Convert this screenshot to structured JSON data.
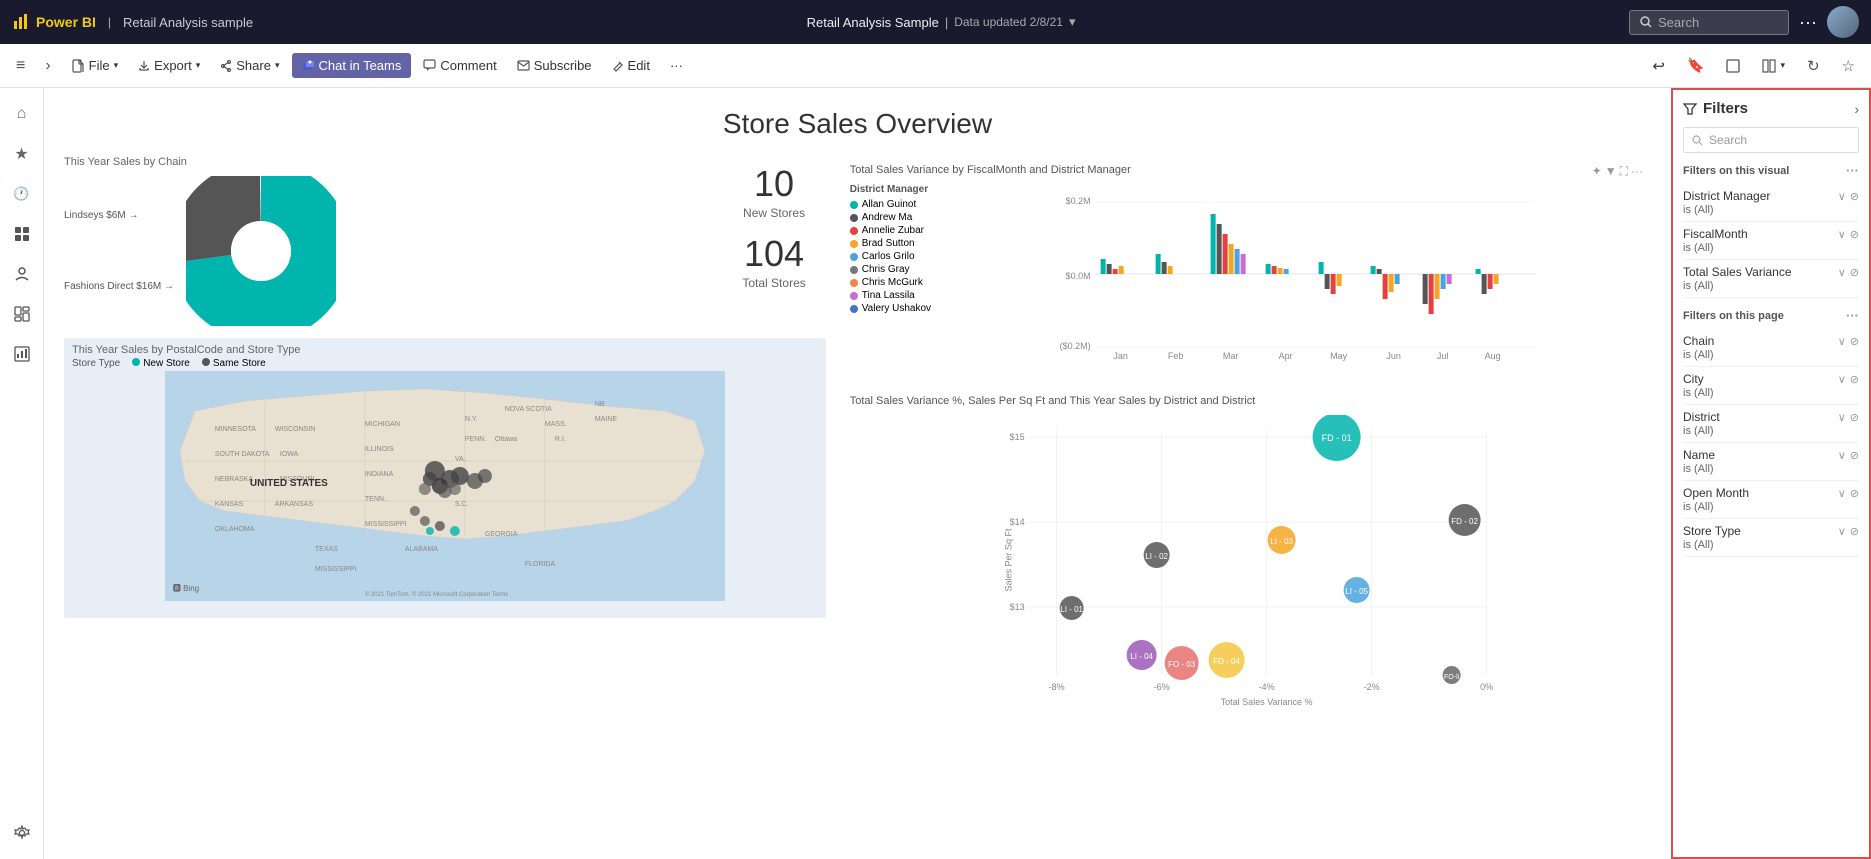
{
  "topbar": {
    "logo": "Power BI",
    "report_title": "Retail Analysis sample",
    "center_title": "Retail Analysis Sample",
    "separator": "|",
    "data_updated": "Data updated 2/8/21",
    "dropdown_icon": "▾",
    "search_placeholder": "Search",
    "more_icon": "···"
  },
  "secondbar": {
    "menu_icon": "≡",
    "chevron": "›",
    "file_label": "File",
    "export_label": "Export",
    "share_label": "Share",
    "chat_label": "Chat in Teams",
    "comment_label": "Comment",
    "subscribe_label": "Subscribe",
    "edit_label": "Edit",
    "more": "···",
    "undo_icon": "↩",
    "bookmark_icon": "🔖",
    "fullscreen_icon": "⛶",
    "refresh_icon": "↻",
    "favorite_icon": "☆"
  },
  "sidebar": {
    "icons": [
      {
        "name": "home",
        "symbol": "⌂",
        "active": false
      },
      {
        "name": "favorites",
        "symbol": "★",
        "active": false
      },
      {
        "name": "recent",
        "symbol": "🕐",
        "active": false
      },
      {
        "name": "apps",
        "symbol": "⊞",
        "active": false
      },
      {
        "name": "shared",
        "symbol": "👤",
        "active": false
      },
      {
        "name": "workspaces",
        "symbol": "◫",
        "active": false
      },
      {
        "name": "metrics",
        "symbol": "⊟",
        "active": false
      },
      {
        "name": "settings",
        "symbol": "⚙",
        "active": false
      }
    ]
  },
  "page_title": "Store Sales Overview",
  "pie_chart": {
    "title": "This Year Sales by Chain",
    "labels": [
      {
        "name": "Lindseys $6M",
        "color": "#555555",
        "pct": 27
      },
      {
        "name": "Fashions Direct $16M",
        "color": "#00b5ad",
        "pct": 73
      }
    ]
  },
  "kpi": {
    "stores_count": "10",
    "stores_label": "New Stores",
    "total_count": "104",
    "total_label": "Total Stores"
  },
  "map": {
    "title": "This Year Sales by PostalCode and Store Type",
    "legend_label": "Store Type",
    "legend_items": [
      {
        "name": "New Store",
        "color": "#00b5ad"
      },
      {
        "name": "Same Store",
        "color": "#555555"
      }
    ],
    "attribution": "© 2021 TomTom, © 2021 Microsoft Corporation  Terms",
    "bing_label": "Bing"
  },
  "bar_chart": {
    "title": "Total Sales Variance by FiscalMonth and District Manager",
    "legend": [
      {
        "name": "Allan Guinot",
        "color": "#00b5ad"
      },
      {
        "name": "Andrew Ma",
        "color": "#555555"
      },
      {
        "name": "Annelie Zubar",
        "color": "#e84040"
      },
      {
        "name": "Brad Sutton",
        "color": "#f5a623"
      },
      {
        "name": "Carlos Grilo",
        "color": "#4aa3df"
      },
      {
        "name": "Chris Gray",
        "color": "#777777"
      },
      {
        "name": "Chris McGurk",
        "color": "#f5824a"
      },
      {
        "name": "Tina Lassila",
        "color": "#c86dd7"
      },
      {
        "name": "Valery Ushakov",
        "color": "#4472c4"
      }
    ],
    "y_labels": [
      "$0.2M",
      "$0.0M",
      "($0.2M)"
    ],
    "x_labels": [
      "Jan",
      "Feb",
      "Mar",
      "Apr",
      "May",
      "Jun",
      "Jul",
      "Aug"
    ]
  },
  "scatter_chart": {
    "title": "Total Sales Variance %, Sales Per Sq Ft and This Year Sales by District and District",
    "y_axis_label": "Sales Per Sq Ft",
    "x_axis_label": "Total Sales Variance %",
    "y_labels": [
      "$15",
      "$14",
      "$13"
    ],
    "x_labels": [
      "-8%",
      "-6%",
      "-4%",
      "-2%",
      "0%"
    ],
    "bubbles": [
      {
        "label": "FD - 01",
        "x": 68,
        "y": 15,
        "size": 50,
        "color": "#00b5ad"
      },
      {
        "label": "FD - 02",
        "x": 93,
        "y": 50,
        "size": 30,
        "color": "#555555"
      },
      {
        "label": "LI - 01",
        "x": 8,
        "y": 78,
        "size": 20,
        "color": "#555555"
      },
      {
        "label": "LI - 02",
        "x": 32,
        "y": 50,
        "size": 22,
        "color": "#555555"
      },
      {
        "label": "LI - 03",
        "x": 58,
        "y": 40,
        "size": 25,
        "color": "#f5a623"
      },
      {
        "label": "LI - 04",
        "x": 28,
        "y": 88,
        "size": 26,
        "color": "#9b59b6"
      },
      {
        "label": "LI - 05",
        "x": 72,
        "y": 60,
        "size": 22,
        "color": "#4aa3df"
      },
      {
        "label": "FO - 03",
        "x": 37,
        "y": 82,
        "size": 28,
        "color": "#e84040"
      },
      {
        "label": "FD - 04",
        "x": 48,
        "y": 82,
        "size": 30,
        "color": "#f5a623"
      },
      {
        "label": "FO - li",
        "x": 85,
        "y": 92,
        "size": 16,
        "color": "#555"
      }
    ]
  },
  "filters": {
    "title": "Filters",
    "search_placeholder": "Search",
    "close_icon": "›",
    "sections": [
      {
        "label": "Filters on this visual",
        "more_icon": "···",
        "items": [
          {
            "name": "District Manager",
            "value": "is (All)"
          },
          {
            "name": "FiscalMonth",
            "value": "is (All)"
          },
          {
            "name": "Total Sales Variance",
            "value": "is (All)"
          }
        ]
      },
      {
        "label": "Filters on this page",
        "more_icon": "···",
        "items": [
          {
            "name": "Chain",
            "value": "is (All)"
          },
          {
            "name": "City",
            "value": "is (All)"
          },
          {
            "name": "District",
            "value": "is (All)"
          },
          {
            "name": "Name",
            "value": "is (All)"
          },
          {
            "name": "Open Month",
            "value": "is (All)"
          },
          {
            "name": "Store Type",
            "value": "is (All)"
          }
        ]
      }
    ]
  }
}
